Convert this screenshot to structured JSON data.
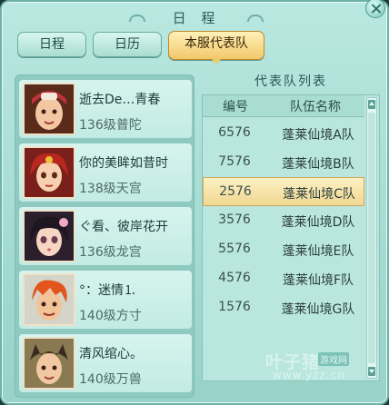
{
  "window": {
    "title": "日 程"
  },
  "tabs": [
    {
      "label": "日程",
      "active": false
    },
    {
      "label": "日历",
      "active": false
    },
    {
      "label": "本服代表队",
      "active": true
    }
  ],
  "players": [
    {
      "name": "逝去De…青春",
      "level": "136级普陀",
      "avatar": "player-portrait-1"
    },
    {
      "name": "你的美眸如昔时",
      "level": "138级天宫",
      "avatar": "player-portrait-2"
    },
    {
      "name": "ぐ看、彼岸花开",
      "level": "136级龙宫",
      "avatar": "player-portrait-3"
    },
    {
      "name": "°：迷情⒈",
      "level": "140级方寸",
      "avatar": "player-portrait-4"
    },
    {
      "name": "清风绾心。",
      "level": "140级万兽",
      "avatar": "player-portrait-5"
    }
  ],
  "team_list": {
    "title": "代表队列表",
    "columns": [
      "编号",
      "队伍名称"
    ],
    "rows": [
      {
        "num": "6576",
        "team": "蓬莱仙境A队",
        "highlighted": false
      },
      {
        "num": "7576",
        "team": "蓬莱仙境B队",
        "highlighted": false
      },
      {
        "num": "2576",
        "team": "蓬莱仙境C队",
        "highlighted": true
      },
      {
        "num": "3576",
        "team": "蓬莱仙境D队",
        "highlighted": false
      },
      {
        "num": "5576",
        "team": "蓬莱仙境E队",
        "highlighted": false
      },
      {
        "num": "4576",
        "team": "蓬莱仙境F队",
        "highlighted": false
      },
      {
        "num": "1576",
        "team": "蓬莱仙境G队",
        "highlighted": false
      }
    ]
  },
  "watermark": {
    "brand": "叶子猪",
    "tag": "游戏网",
    "url": "www.yzz.cn"
  },
  "colors": {
    "accent": "#f1c86a",
    "panel": "#a6dcd3",
    "text": "#1f3a38"
  }
}
